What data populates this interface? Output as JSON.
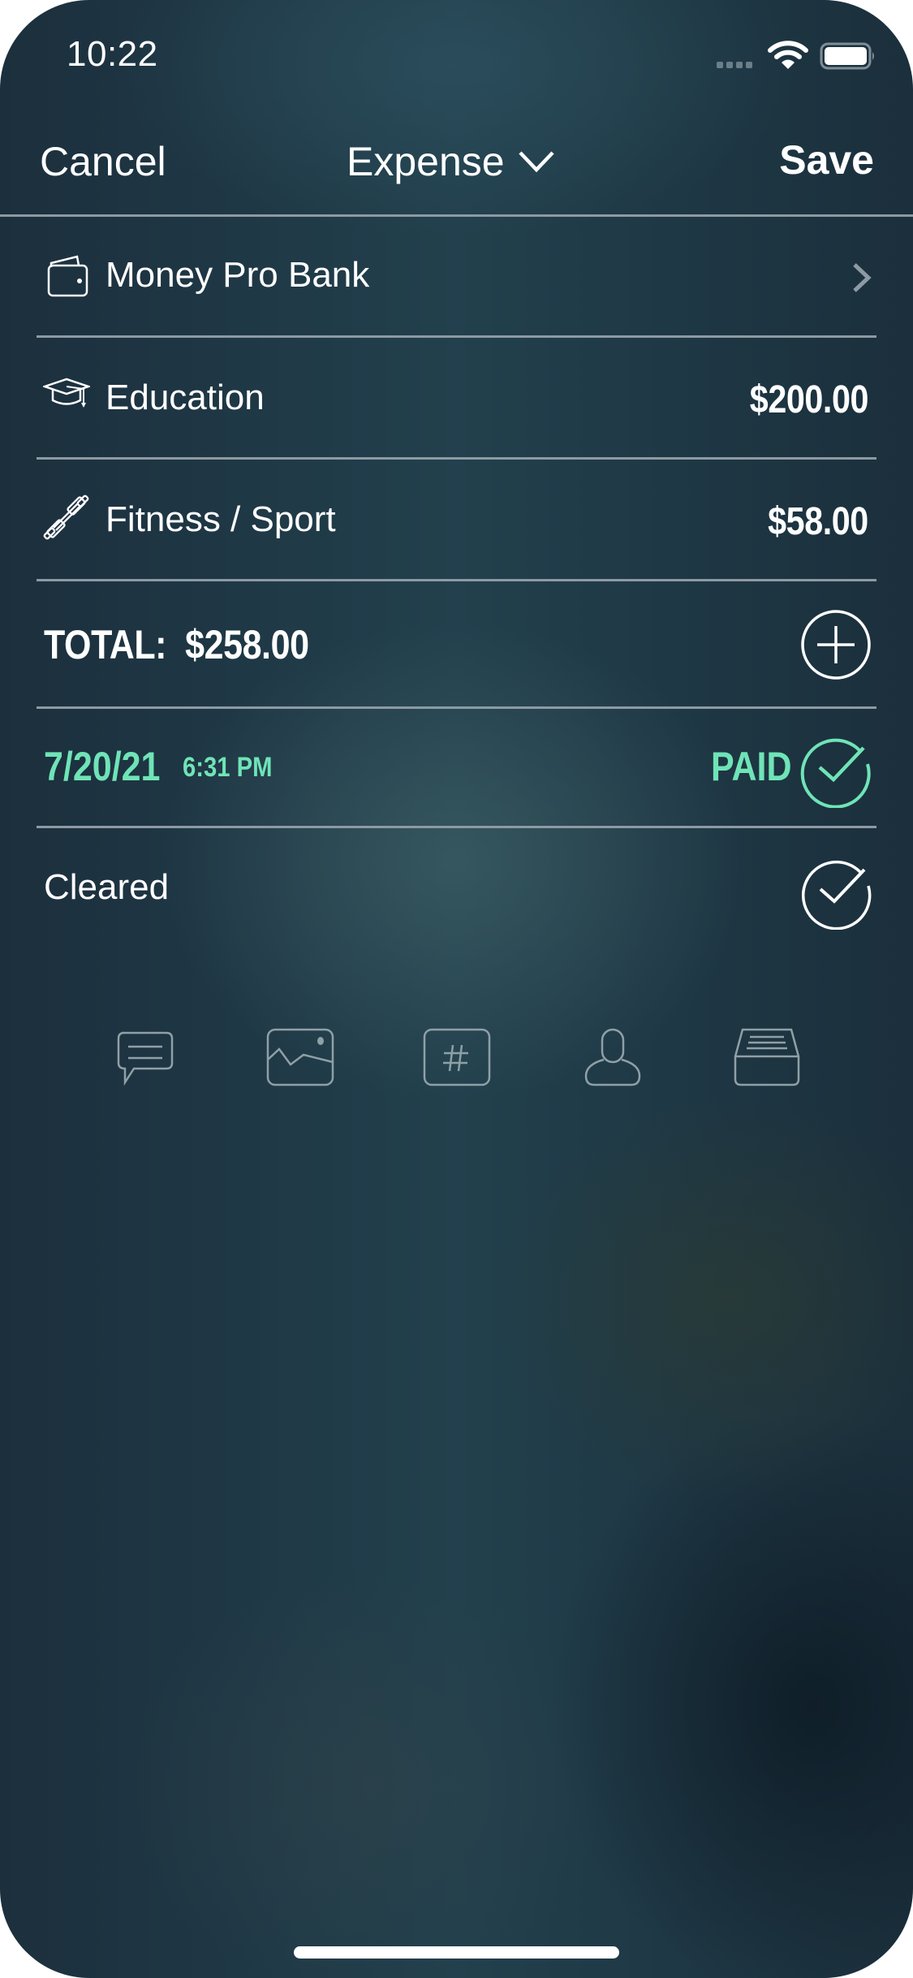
{
  "status_bar": {
    "time": "10:22",
    "signal_icon": "cellular-signal-icon",
    "wifi_icon": "wifi-icon",
    "battery_icon": "battery-icon"
  },
  "nav": {
    "cancel_label": "Cancel",
    "title": "Expense",
    "title_icon": "chevron-down-icon",
    "save_label": "Save"
  },
  "account": {
    "icon": "wallet-icon",
    "name": "Money Pro Bank",
    "disclosure_icon": "chevron-right-icon"
  },
  "categories": [
    {
      "icon": "graduation-cap-icon",
      "name": "Education",
      "amount": "$200.00"
    },
    {
      "icon": "dumbbell-icon",
      "name": "Fitness / Sport",
      "amount": "$58.00"
    }
  ],
  "total": {
    "label": "TOTAL:",
    "amount": "$258.00",
    "add_icon": "plus-circle-icon"
  },
  "date_row": {
    "date": "7/20/21",
    "time": "6:31 PM",
    "status": "PAID",
    "status_icon": "check-circle-icon",
    "accent_color": "#6fe4b7"
  },
  "cleared_row": {
    "label": "Cleared",
    "icon": "check-circle-icon"
  },
  "attachments": [
    {
      "icon": "comment-icon"
    },
    {
      "icon": "image-icon"
    },
    {
      "icon": "hashtag-icon"
    },
    {
      "icon": "person-icon"
    },
    {
      "icon": "archive-box-icon"
    }
  ]
}
